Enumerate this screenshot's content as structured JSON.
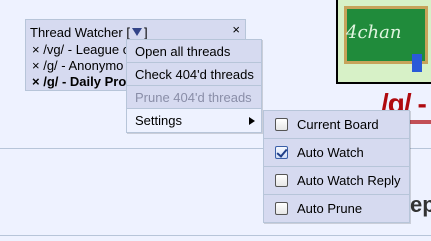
{
  "page": {
    "banner_text": "4chan",
    "board_title": "/g/ -",
    "fragment_text": "ep"
  },
  "thread_watcher": {
    "title": "Thread Watcher",
    "bracket_open": "[",
    "bracket_close": "]",
    "close_glyph": "×",
    "items": [
      {
        "label": "× /vg/ - League o"
      },
      {
        "label": "× /g/ - Anonymo"
      },
      {
        "label": "× /g/ - Daily Pro"
      }
    ]
  },
  "menu": {
    "items": [
      {
        "label": "Open all threads",
        "enabled": true
      },
      {
        "label": "Check 404'd threads",
        "enabled": true
      },
      {
        "label": "Prune 404'd threads",
        "enabled": false
      },
      {
        "label": "Settings",
        "enabled": true,
        "has_submenu": true
      }
    ]
  },
  "settings_menu": {
    "items": [
      {
        "label": "Current Board",
        "checked": false
      },
      {
        "label": "Auto Watch",
        "checked": true
      },
      {
        "label": "Auto Watch Reply",
        "checked": false
      },
      {
        "label": "Auto Prune",
        "checked": false
      }
    ]
  },
  "colors": {
    "background": "#eef2ff",
    "panel": "#d6daf0",
    "border": "#b7c5d9",
    "title_red": "#af0a0f",
    "disabled_text": "#8a8ea8"
  }
}
